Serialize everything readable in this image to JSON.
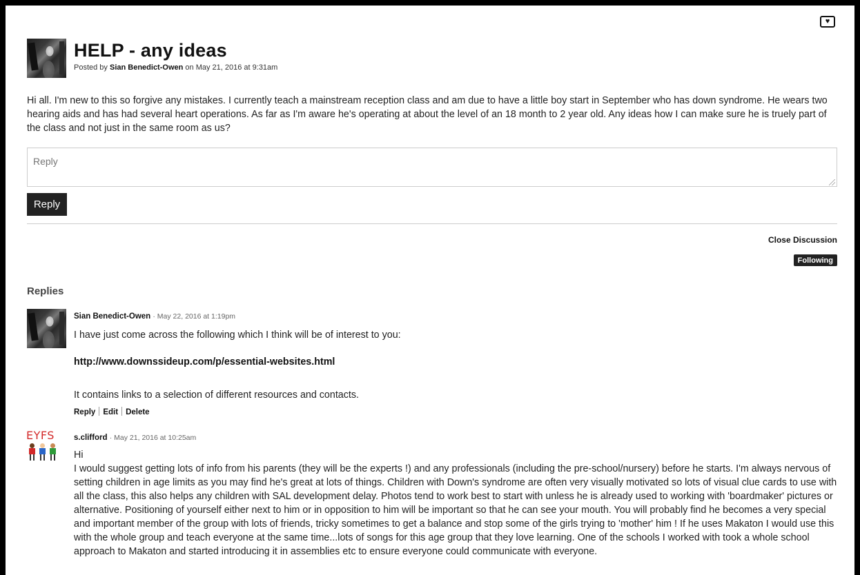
{
  "post": {
    "title": "HELP - any ideas",
    "meta_prefix": "Posted by",
    "author": "Sian Benedict-Owen",
    "meta_suffix": "on May 21, 2016 at 9:31am",
    "body": "Hi all. I'm new to this so forgive any mistakes. I currently teach a mainstream reception class and am due to have a little boy start in September who has down syndrome. He wears two hearing aids and has had several heart operations. As far as I'm aware he's operating at about the level of an 18 month to 2 year old. Any ideas how I can make sure he is truely part of the class and not just in the same room as us?"
  },
  "reply_form": {
    "placeholder": "Reply",
    "submit_label": "Reply"
  },
  "discussion_actions": {
    "close_label": "Close Discussion",
    "following_label": "Following"
  },
  "replies": {
    "heading": "Replies",
    "items": [
      {
        "author": "Sian Benedict-Owen",
        "date": "· May 22, 2016 at 1:19pm",
        "text_1": "I have just come across the following which I think will be of interest to you:",
        "link": "http://www.downssideup.com/p/essential-websites.html",
        "text_2": "It contains links to a selection of different resources and contacts.",
        "actions": [
          "Reply",
          "Edit",
          "Delete"
        ]
      },
      {
        "author": "s.clifford",
        "date": "· May 21, 2016 at 10:25am",
        "avatar_text": "EYFS",
        "greeting": "Hi",
        "body": "I would suggest getting lots of info from his parents (they will be the experts !) and any professionals (including the pre-school/nursery) before he starts. I'm always nervous of setting children in age limits as you may find he's great at lots of things. Children with Down's syndrome are often very visually motivated so lots of visual clue cards to use with all the class, this also helps any children with SAL development delay. Photos tend to work best to start with unless he is already used to working with 'boardmaker' pictures or alternative. Positioning of yourself either next to him or in opposition to him will be important so that he can see your mouth. You will probably find he becomes a very special and important member of the group with lots of friends, tricky sometimes to get a balance and stop some of the girls trying to 'mother' him ! If he uses Makaton I would use this with the whole group and teach everyone at the same time...lots of songs for this age group that they love learning. One of the schools I worked with took a whole school approach to Makaton and started introducing it in assemblies etc to ensure everyone could communicate with everyone."
      }
    ]
  },
  "icons": {
    "heart": "heart-icon"
  }
}
